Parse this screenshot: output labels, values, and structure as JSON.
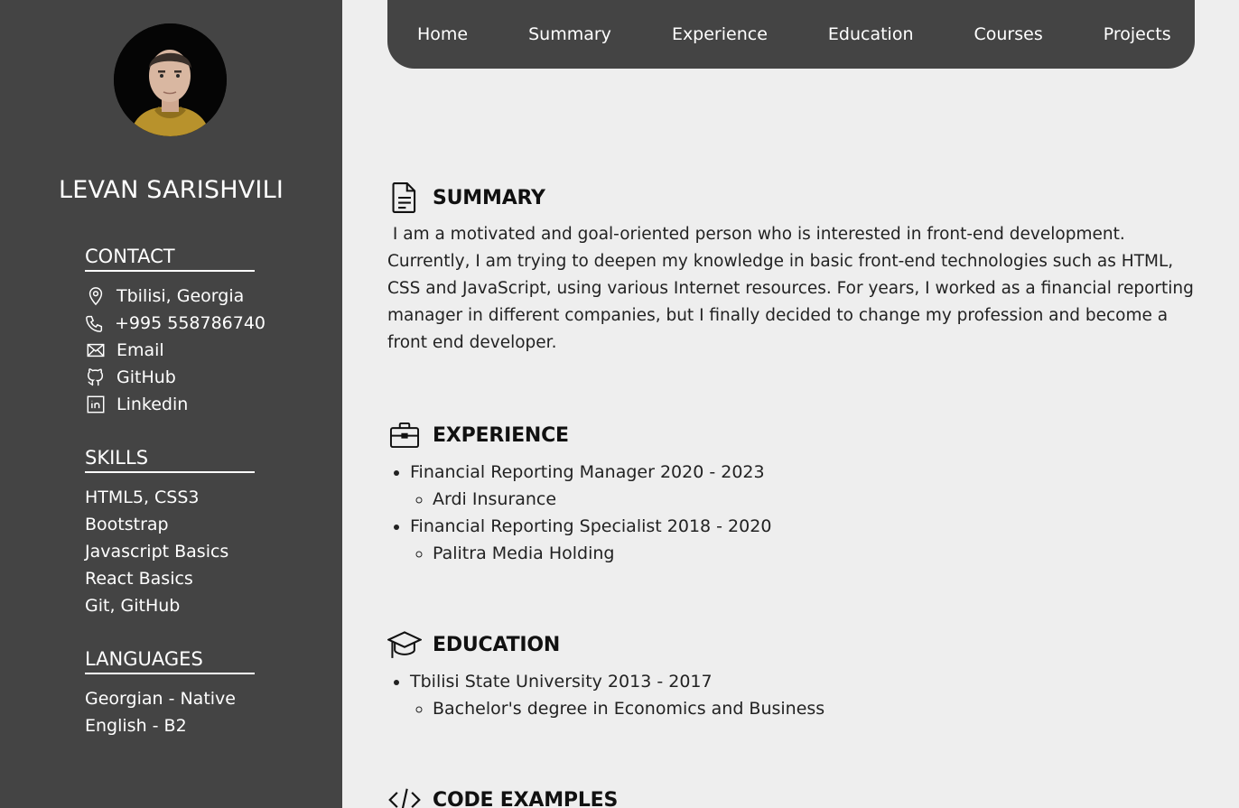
{
  "profile": {
    "name": "LEVAN SARISHVILI"
  },
  "contact": {
    "heading": "CONTACT",
    "items": [
      {
        "icon": "location-pin-icon",
        "text": "Tbilisi, Georgia"
      },
      {
        "icon": "phone-icon",
        "text": "+995 558786740"
      },
      {
        "icon": "envelope-icon",
        "text": "Email"
      },
      {
        "icon": "github-icon",
        "text": "GitHub"
      },
      {
        "icon": "linkedin-icon",
        "text": "Linkedin"
      }
    ]
  },
  "skills": {
    "heading": "SKILLS",
    "items": [
      "HTML5, CSS3",
      "Bootstrap",
      "Javascript Basics",
      "React Basics",
      "Git, GitHub"
    ]
  },
  "languages": {
    "heading": "LANGUAGES",
    "items": [
      "Georgian - Native",
      "English - B2"
    ]
  },
  "nav": {
    "items": [
      "Home",
      "Summary",
      "Experience",
      "Education",
      "Courses",
      "Projects"
    ]
  },
  "summary": {
    "title": "SUMMARY",
    "icon": "document-icon",
    "text": " I am a motivated and goal-oriented person who is interested in front-end development. Currently, I am trying to deepen my knowledge in basic front-end technologies such as HTML, CSS and JavaScript, using various Internet resources. For years, I worked as a financial reporting manager in different companies, but I finally decided to change my profession and become a front end developer."
  },
  "experience": {
    "title": "EXPERIENCE",
    "icon": "briefcase-icon",
    "items": [
      {
        "role": "Financial Reporting Manager 2020 - 2023",
        "company": "Ardi Insurance"
      },
      {
        "role": "Financial Reporting Specialist 2018 - 2020",
        "company": "Palitra Media Holding"
      }
    ]
  },
  "education": {
    "title": "EDUCATION",
    "icon": "graduation-cap-icon",
    "items": [
      {
        "school": "Tbilisi State University 2013 - 2017",
        "degree": "Bachelor's degree in Economics and Business"
      }
    ]
  },
  "code_examples": {
    "title": "CODE EXAMPLES",
    "icon": "code-icon"
  }
}
